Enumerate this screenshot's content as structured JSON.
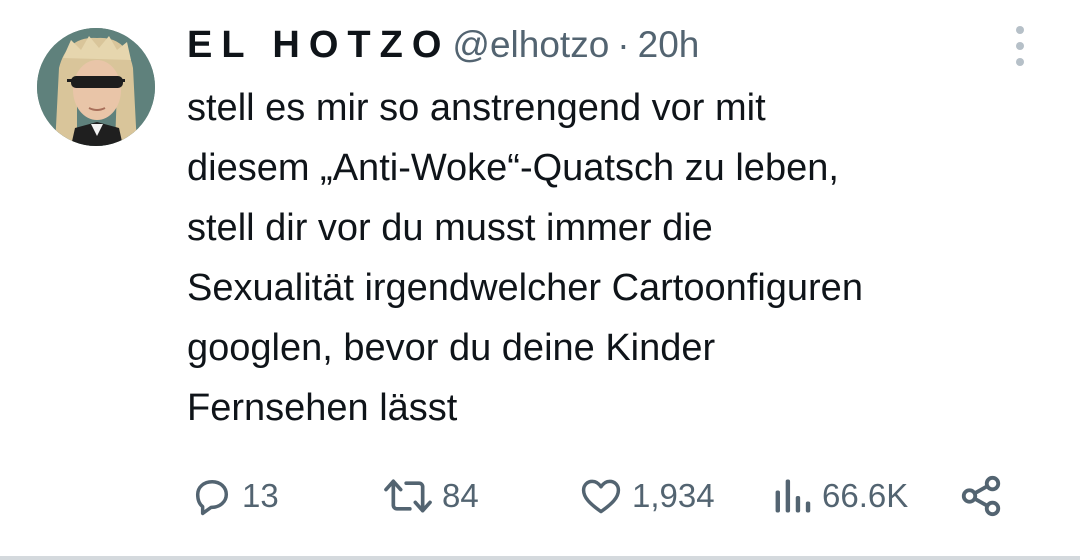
{
  "author": {
    "display_name": "EL HOTZO",
    "handle": "@elhotzo",
    "separator": "·",
    "time": "20h"
  },
  "tweet": {
    "lines": [
      "stell es mir so anstrengend vor mit",
      "diesem „Anti-Woke“-Quatsch zu leben,",
      "stell dir vor du musst immer die",
      "Sexualität irgendwelcher Cartoonfiguren",
      "googlen, bevor du deine Kinder",
      "Fernsehen lässt"
    ]
  },
  "actions": {
    "replies": "13",
    "retweets": "84",
    "likes": "1,934",
    "views": "66.6K"
  },
  "icons": {
    "reply": "reply-icon",
    "retweet": "retweet-icon",
    "like": "heart-icon",
    "views": "views-icon",
    "share": "share-icon",
    "more": "more-icon"
  },
  "colors": {
    "text": "#0f1419",
    "secondary": "#536471"
  }
}
